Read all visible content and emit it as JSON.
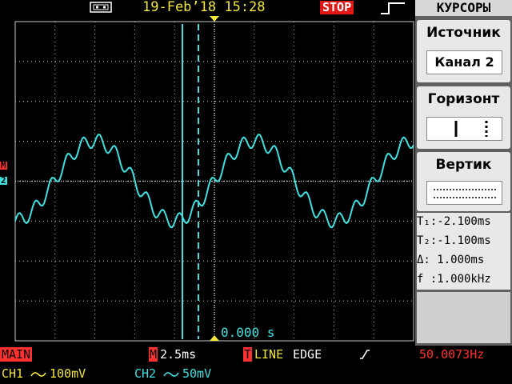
{
  "status": {
    "date_time": "19-Feb’18 15:28",
    "run_state": "STOP",
    "usb_icon": "usb-icon",
    "trigger_shape_icon": "rising-edge-icon"
  },
  "menu": {
    "title": "КУРСОРЫ",
    "source": {
      "label": "Источник",
      "value": "Канал 2"
    },
    "horizontal": {
      "label": "Горизонт"
    },
    "vertical": {
      "label": "Вертик"
    }
  },
  "readouts": {
    "t1": "T₁:-2.100ms",
    "t2": "T₂:-1.100ms",
    "delta": "Δ: 1.000ms",
    "freq": "f :1.000kHz"
  },
  "display": {
    "time_offset": "0.000 s",
    "ch_marker_m": "M",
    "ch_marker_2": "2"
  },
  "bottom_bar": {
    "main_label": "MAIN",
    "timebase_prefix": "M",
    "timebase": "2.5ms",
    "trigger_prefix": "T",
    "trigger_source": "LINE",
    "trigger_type": "EDGE",
    "trigger_slope_icon": "slope-rising-icon",
    "frequency": "50.0073Hz",
    "ch1_label": "CH1",
    "ch1_coupling_icon": "ac-coupling-icon",
    "ch1_scale": "100mV",
    "ch2_label": "CH2",
    "ch2_coupling_icon": "ac-coupling-icon",
    "ch2_scale": "50mV"
  },
  "colors": {
    "trace": "#3ee0e0",
    "grid": "#c8c8c8",
    "label_yellow": "#f0e63c",
    "label_red": "#ff3030",
    "stop_bg": "#e01818"
  }
}
